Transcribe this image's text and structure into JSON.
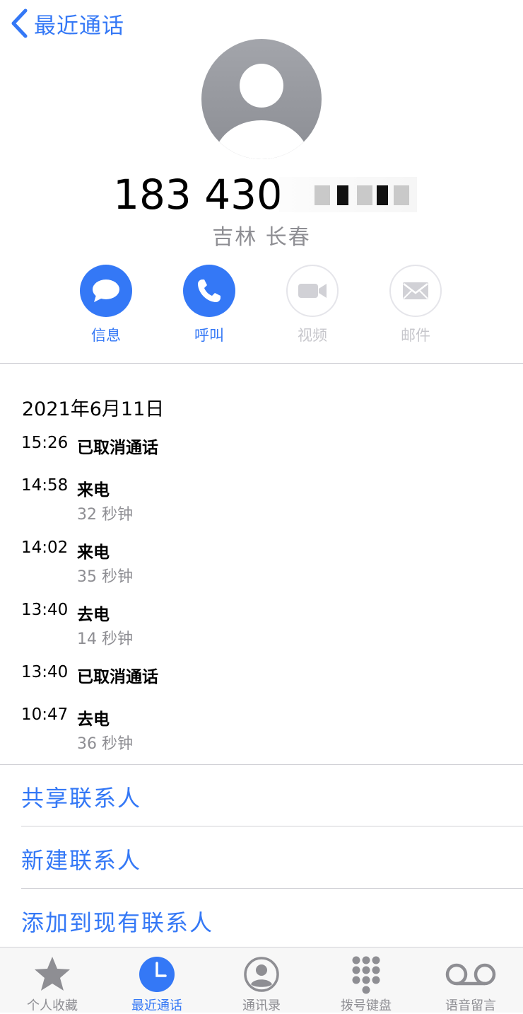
{
  "nav": {
    "back_label": "最近通话"
  },
  "contact": {
    "number": "183 430",
    "location": "吉林 长春"
  },
  "actions": [
    {
      "label": "信息",
      "icon": "message-icon",
      "enabled": true
    },
    {
      "label": "呼叫",
      "icon": "phone-icon",
      "enabled": true
    },
    {
      "label": "视频",
      "icon": "video-icon",
      "enabled": false
    },
    {
      "label": "邮件",
      "icon": "mail-icon",
      "enabled": false
    }
  ],
  "history": {
    "date": "2021年6月11日",
    "calls": [
      {
        "time": "15:26",
        "type": "已取消通话",
        "duration": ""
      },
      {
        "time": "14:58",
        "type": "来电",
        "duration": "32 秒钟"
      },
      {
        "time": "14:02",
        "type": "来电",
        "duration": "35 秒钟"
      },
      {
        "time": "13:40",
        "type": "去电",
        "duration": "14 秒钟"
      },
      {
        "time": "13:40",
        "type": "已取消通话",
        "duration": ""
      },
      {
        "time": "10:47",
        "type": "去电",
        "duration": "36 秒钟"
      }
    ]
  },
  "links": [
    "共享联系人",
    "新建联系人",
    "添加到现有联系人"
  ],
  "tabbar": {
    "active": 1,
    "tabs": [
      {
        "label": "个人收藏",
        "icon": "star-icon"
      },
      {
        "label": "最近通话",
        "icon": "clock-icon"
      },
      {
        "label": "通讯录",
        "icon": "contacts-icon"
      },
      {
        "label": "拨号键盘",
        "icon": "keypad-icon"
      },
      {
        "label": "语音留言",
        "icon": "voicemail-icon"
      }
    ]
  },
  "colors": {
    "accent": "#3478f6",
    "gray": "#8e8e93",
    "disabled": "#c7c7cc"
  }
}
